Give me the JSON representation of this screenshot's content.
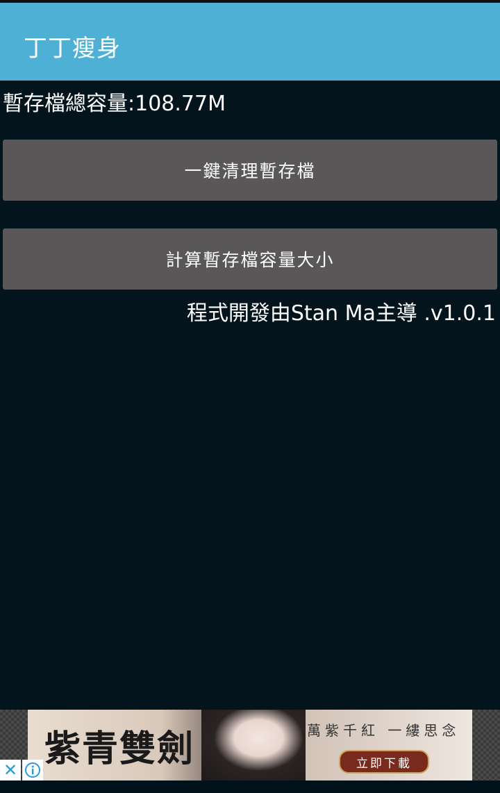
{
  "app": {
    "title": "丁丁瘦身"
  },
  "main": {
    "cache_total": "暫存檔總容量:108.77M",
    "clean_button": "一鍵清理暫存檔",
    "calculate_button": "計算暫存檔容量大小",
    "credit": "程式開發由Stan Ma主導 .v1.0.1"
  },
  "ad": {
    "game_title": "紫青雙劍",
    "slogan": "萬紫千紅 一縷思念",
    "download_label": "立即下載",
    "close_glyph": "✕"
  },
  "colors": {
    "action_bar": "#4db0d4",
    "background": "#03141c",
    "button": "#5a5759"
  }
}
